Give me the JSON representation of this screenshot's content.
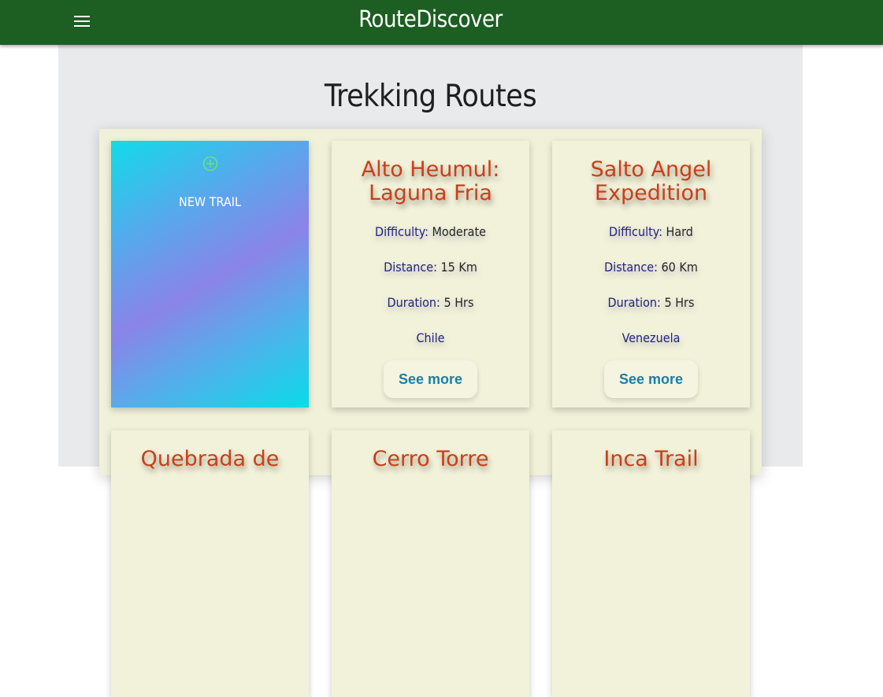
{
  "header": {
    "brand": "RouteDiscover",
    "menu_icon": "hamburger-menu-icon",
    "background": "#1d5e22"
  },
  "page": {
    "title": "Trekking Routes"
  },
  "new_trail": {
    "label": "NEW TRAIL",
    "icon": "plus-circle-icon"
  },
  "routes": [
    {
      "name": "Alto Heumul: Laguna Fria",
      "difficulty_label": "Difficulty:",
      "difficulty": "Moderate",
      "distance_label": "Distance:",
      "distance": "15 Km",
      "duration_label": "Duration:",
      "duration": "5 Hrs",
      "country": "Chile",
      "button": "See more"
    },
    {
      "name": "Salto Angel Expedition",
      "difficulty_label": "Difficulty:",
      "difficulty": "Hard",
      "distance_label": "Distance:",
      "distance": "60 Km",
      "duration_label": "Duration:",
      "duration": "5 Hrs",
      "country": "Venezuela",
      "button": "See more"
    },
    {
      "name": "Quebrada de"
    },
    {
      "name": "Cerro Torre"
    },
    {
      "name": "Inca Trail"
    }
  ],
  "colors": {
    "title": "#c93f19",
    "label": "#23237e",
    "button_text": "#1b7fa6"
  }
}
